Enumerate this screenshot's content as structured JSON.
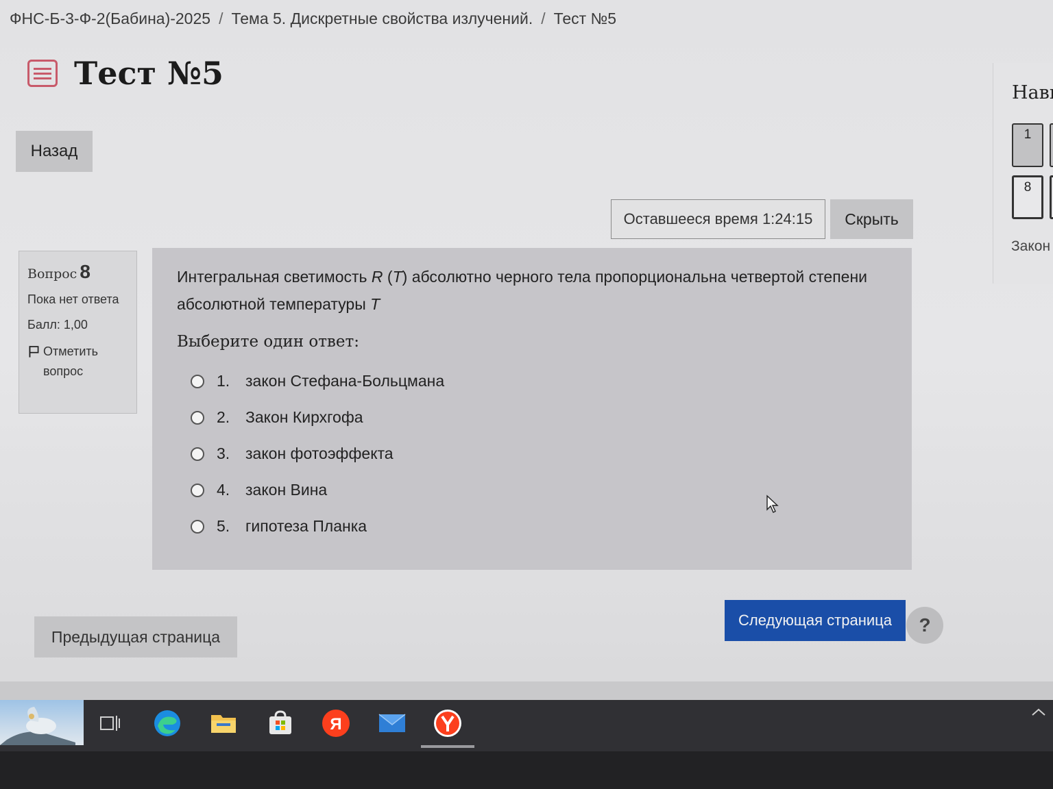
{
  "breadcrumb": {
    "course": "ФНС-Б-3-Ф-2(Бабина)-2025",
    "topic": "Тема 5. Дискретные свойства излучений.",
    "current": "Тест №5",
    "separator": "/"
  },
  "header": {
    "title": "Тест №5",
    "back_label": "Назад"
  },
  "timer": {
    "text": "Оставшееся время 1:24:15",
    "hide_label": "Скрыть"
  },
  "question_info": {
    "label": "Вопрос",
    "number": "8",
    "status": "Пока нет ответа",
    "grade": "Балл: 1,00",
    "flag_label": "Отметить вопрос"
  },
  "question": {
    "text_part1": "Интегральная светимость ",
    "var_R": "R",
    "text_part2": " (",
    "var_T1": "T",
    "text_part3": ") абсолютно черного тела пропорциональна четвертой степени абсолютной температуры ",
    "var_T2": "T",
    "prompt": "Выберите один ответ:",
    "answers": [
      {
        "num": "1.",
        "label": "закон Стефана-Больцмана"
      },
      {
        "num": "2.",
        "label": "Закон Кирхгофа"
      },
      {
        "num": "3.",
        "label": "закон фотоэффекта"
      },
      {
        "num": "4.",
        "label": "закон Вина"
      },
      {
        "num": "5.",
        "label": "гипотеза Планка"
      }
    ]
  },
  "footer": {
    "prev_label": "Предыдущая страница",
    "next_label": "Следующая страница",
    "help_label": "?"
  },
  "nav_panel": {
    "title": "Нави",
    "buttons": [
      "1",
      "8"
    ],
    "finish_label": "Закон"
  },
  "colors": {
    "primary": "#1a4ea8",
    "quiz_icon": "#c85a6a",
    "question_bg": "#c6c5c9"
  },
  "taskbar": {
    "icons": [
      "task-view-icon",
      "edge-icon",
      "file-explorer-icon",
      "store-icon",
      "yandex-icon",
      "mail-icon",
      "yandex-browser-icon"
    ]
  }
}
